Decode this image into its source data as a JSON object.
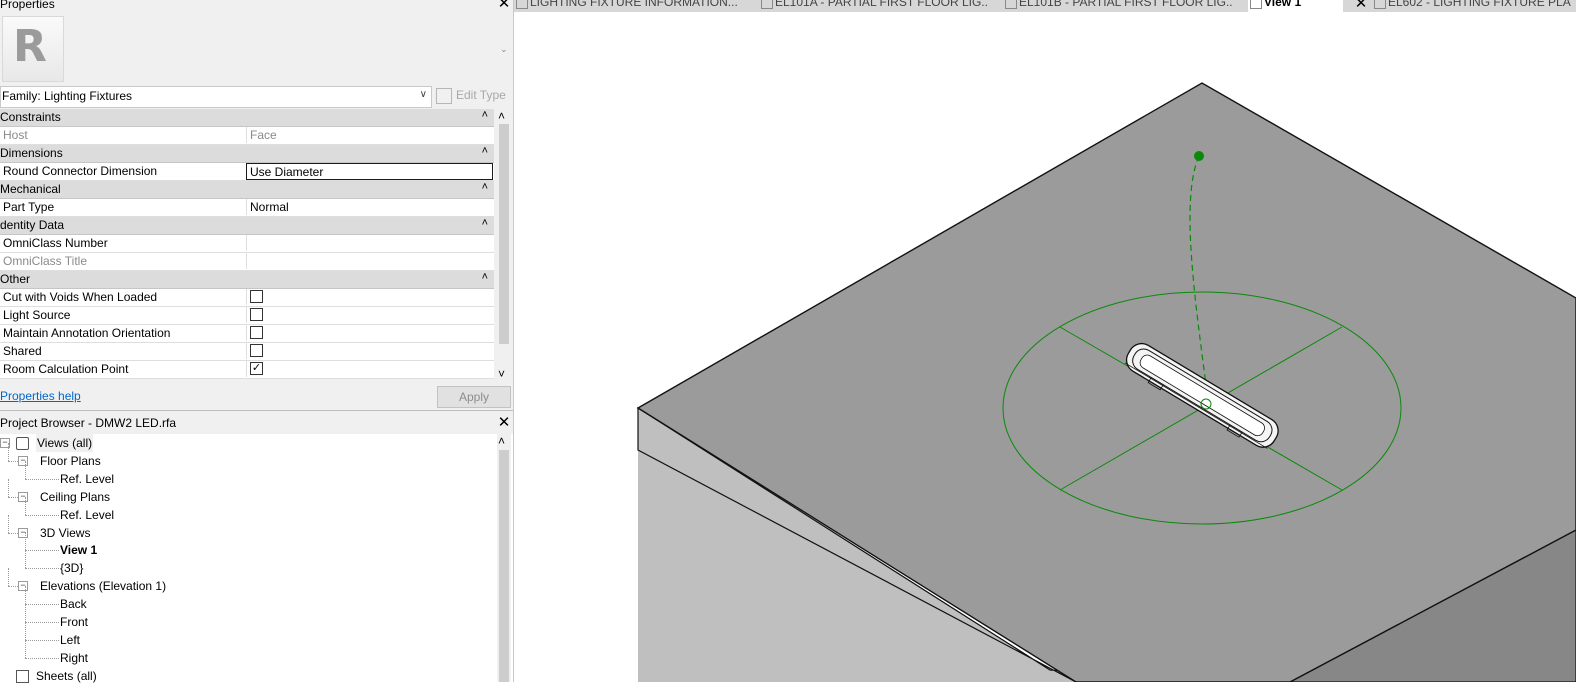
{
  "properties": {
    "title": "Properties",
    "family_selector": "Family: Lighting Fixtures",
    "edit_type": "Edit Type",
    "groups": [
      {
        "name": "Constraints",
        "rows": [
          {
            "key": "Host",
            "value": "Face",
            "readonly": true
          }
        ]
      },
      {
        "name": "Dimensions",
        "rows": [
          {
            "key": "Round Connector Dimension",
            "value": "Use Diameter",
            "editing": true
          }
        ]
      },
      {
        "name": "Mechanical",
        "rows": [
          {
            "key": "Part Type",
            "value": "Normal"
          }
        ]
      },
      {
        "name": "dentity Data",
        "rows": [
          {
            "key": "OmniClass Number",
            "value": ""
          },
          {
            "key": "OmniClass Title",
            "value": "",
            "readonly": true
          }
        ]
      },
      {
        "name": "Other",
        "rows": [
          {
            "key": "Cut with Voids When Loaded",
            "checkbox": false
          },
          {
            "key": "Light Source",
            "checkbox": false
          },
          {
            "key": "Maintain Annotation Orientation",
            "checkbox": false
          },
          {
            "key": "Shared",
            "checkbox": false
          },
          {
            "key": "Room Calculation Point",
            "checkbox": true
          }
        ]
      }
    ],
    "help_link": "Properties help",
    "apply": "Apply",
    "collapse_glyph": "˄",
    "check_glyph": "✓"
  },
  "browser": {
    "title": "Project Browser - DMW2 LED.rfa",
    "nodes": [
      {
        "label": "Views (all)",
        "level": 0,
        "expander": "-",
        "icon": "views-icon"
      },
      {
        "label": "Floor Plans",
        "level": 1,
        "expander": "-"
      },
      {
        "label": "Ref. Level",
        "level": 2
      },
      {
        "label": "Ceiling Plans",
        "level": 1,
        "expander": "-"
      },
      {
        "label": "Ref. Level",
        "level": 2
      },
      {
        "label": "3D Views",
        "level": 1,
        "expander": "-"
      },
      {
        "label": "View 1",
        "level": 2,
        "bold": true
      },
      {
        "label": "{3D}",
        "level": 2
      },
      {
        "label": "Elevations (Elevation 1)",
        "level": 1,
        "expander": "-"
      },
      {
        "label": "Back",
        "level": 2
      },
      {
        "label": "Front",
        "level": 2
      },
      {
        "label": "Left",
        "level": 2
      },
      {
        "label": "Right",
        "level": 2
      },
      {
        "label": "Sheets (all)",
        "level": 0,
        "icon": "sheets-icon"
      }
    ]
  },
  "tabs": [
    {
      "label": "LIGHTING FIXTURE INFORMATION...",
      "active": false
    },
    {
      "label": "EL101A - PARTIAL FIRST FLOOR LIG...",
      "active": false
    },
    {
      "label": "EL101B - PARTIAL FIRST FLOOR LIG...",
      "active": false
    },
    {
      "label": "View 1",
      "active": true
    },
    {
      "label": "EL602 - LIGHTING FIXTURE PLA",
      "active": false
    }
  ],
  "colors": {
    "slab_top": "#9b9b9b",
    "slab_left": "#bfbfbf",
    "slab_right": "#878787",
    "edge": "#111111",
    "light_cone": "#0a8a0a"
  },
  "icons": {
    "close": "✕",
    "dropdown": "⌄",
    "scroll_up": "˄",
    "scroll_down": "˅"
  }
}
